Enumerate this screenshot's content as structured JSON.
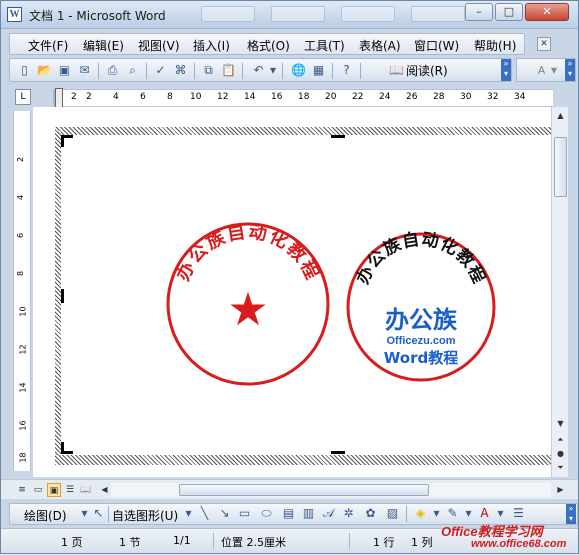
{
  "window": {
    "icon_letter": "W",
    "title": "文档 1 - Microsoft Word",
    "minimize": "–",
    "maximize": "□",
    "close": "✕"
  },
  "menu": {
    "items": [
      "文件(F)",
      "编辑(E)",
      "视图(V)",
      "插入(I)",
      "格式(O)",
      "工具(T)",
      "表格(A)",
      "窗口(W)",
      "帮助(H)"
    ]
  },
  "toolbar": {
    "read_label": "阅读(R)",
    "font_size_label": "A"
  },
  "ruler": {
    "h_ticks": [
      "2",
      "2",
      "4",
      "6",
      "8",
      "10",
      "12",
      "14",
      "16",
      "18",
      "20",
      "22",
      "24",
      "26",
      "28",
      "30",
      "32",
      "34"
    ],
    "v_ticks": [
      "2",
      "4",
      "6",
      "8",
      "10",
      "12",
      "14",
      "16",
      "18"
    ],
    "corner": "L"
  },
  "stamps": {
    "left_text": "办公族自动化教程",
    "left_star": "★",
    "right_text": "办公族自动化教程",
    "right_logo": "办公族",
    "right_domain": "Officezu.com",
    "right_sub": "Word教程"
  },
  "drawbar": {
    "draw_label": "绘图(D)",
    "autoshape_label": "自选图形(U)"
  },
  "status": {
    "page": "1 页",
    "section": "1 节",
    "pages": "1/1",
    "position": "位置 2.5厘米",
    "line": "1 行",
    "column": "1 列"
  },
  "watermark": {
    "line1": "Office教程学习网",
    "line2": "www.office68.com"
  },
  "colors": {
    "stamp_red": "#d81c1c",
    "titlebar": "#c9d6e6"
  }
}
